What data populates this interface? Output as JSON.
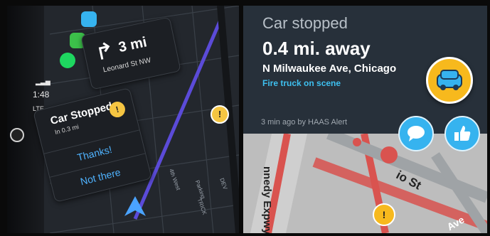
{
  "carplay": {
    "status": {
      "time": "1:48",
      "network": "LTE"
    },
    "turn": {
      "distance": "3 mi",
      "street": "Leonard St NW"
    },
    "alert": {
      "title": "Car Stopped",
      "subtitle": "In 0.3 mi",
      "thanks_label": "Thanks!",
      "not_there_label": "Not there"
    },
    "map_labels": {
      "street_a": "4th West",
      "street_b": "Parking",
      "street_c": "DEV",
      "street_d": "TRICK"
    }
  },
  "waze_alert": {
    "title": "Car stopped",
    "distance": "0.4 mi. away",
    "street": "N Milwaukee Ave, Chicago",
    "description": "Fire truck on scene",
    "meta": "3 min ago by HAAS Alert",
    "icons": {
      "badge": "car-icon",
      "comment": "comment-icon",
      "like": "thumbs-up-icon"
    },
    "map_labels": {
      "expressway": "nnedy Expwy W",
      "street": "io St",
      "ave": "Ave"
    }
  },
  "colors": {
    "waze_blue": "#36b3ef",
    "waze_yellow": "#f7b91d",
    "link_cyan": "#3ec0f0",
    "route_purple": "#5b4bd8",
    "traffic_red": "#d9534f"
  }
}
